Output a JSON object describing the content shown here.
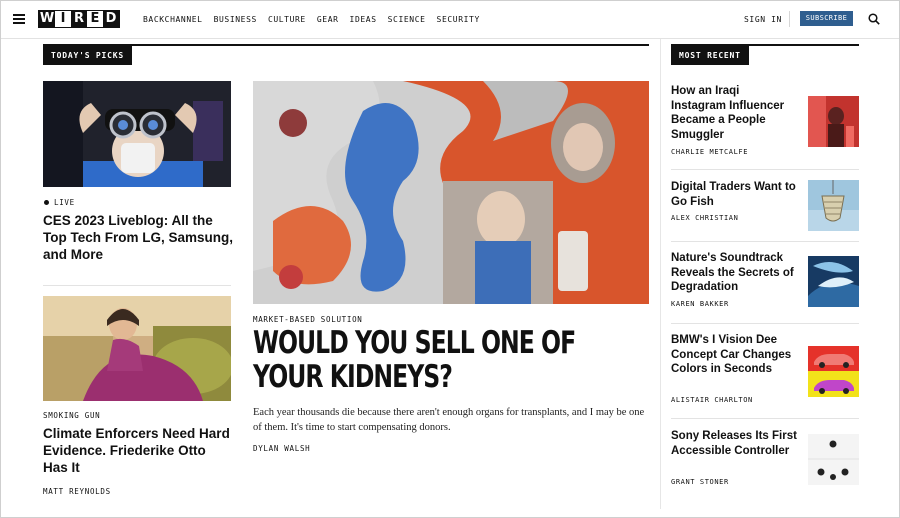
{
  "header": {
    "logo_letters": [
      "W",
      "I",
      "R",
      "E",
      "D"
    ],
    "nav": [
      "BACKCHANNEL",
      "BUSINESS",
      "CULTURE",
      "GEAR",
      "IDEAS",
      "SCIENCE",
      "SECURITY"
    ],
    "sign_in": "SIGN IN",
    "subscribe": "SUBSCRIBE",
    "icons": {
      "menu": "hamburger-menu-icon",
      "search": "search-icon"
    },
    "subscribe_color": "#2f5e8f"
  },
  "todays_picks": {
    "label": "TODAY'S PICKS",
    "left_top": {
      "tag": "LIVE",
      "headline": "CES 2023 Liveblog: All the Top Tech From LG, Samsung, and More"
    },
    "left_bottom": {
      "rubric": "SMOKING GUN",
      "headline": "Climate Enforcers Need Hard Evidence. Friederike Otto Has It",
      "author": "MATT REYNOLDS"
    },
    "feature": {
      "rubric": "MARKET-BASED SOLUTION",
      "headline": "WOULD YOU SELL ONE OF YOUR KIDNEYS?",
      "dek": "Each year thousands die because there aren't enough organs for transplants, and I may be one of them. It's time to start compensating donors.",
      "author": "DYLAN WALSH"
    }
  },
  "most_recent": {
    "label": "MOST RECENT",
    "items": [
      {
        "title": "How an Iraqi Instagram Influencer Became a People Smuggler",
        "author": "CHARLIE METCALFE"
      },
      {
        "title": "Digital Traders Want to Go Fish",
        "author": "ALEX CHRISTIAN"
      },
      {
        "title": "Nature's Soundtrack Reveals the Secrets of Degradation",
        "author": "KAREN BAKKER"
      },
      {
        "title": "BMW's I Vision Dee Concept Car Changes Colors in Seconds",
        "author": "ALISTAIR CHARLTON"
      },
      {
        "title": "Sony Releases Its First Accessible Controller",
        "author": "GRANT STONER"
      }
    ]
  }
}
